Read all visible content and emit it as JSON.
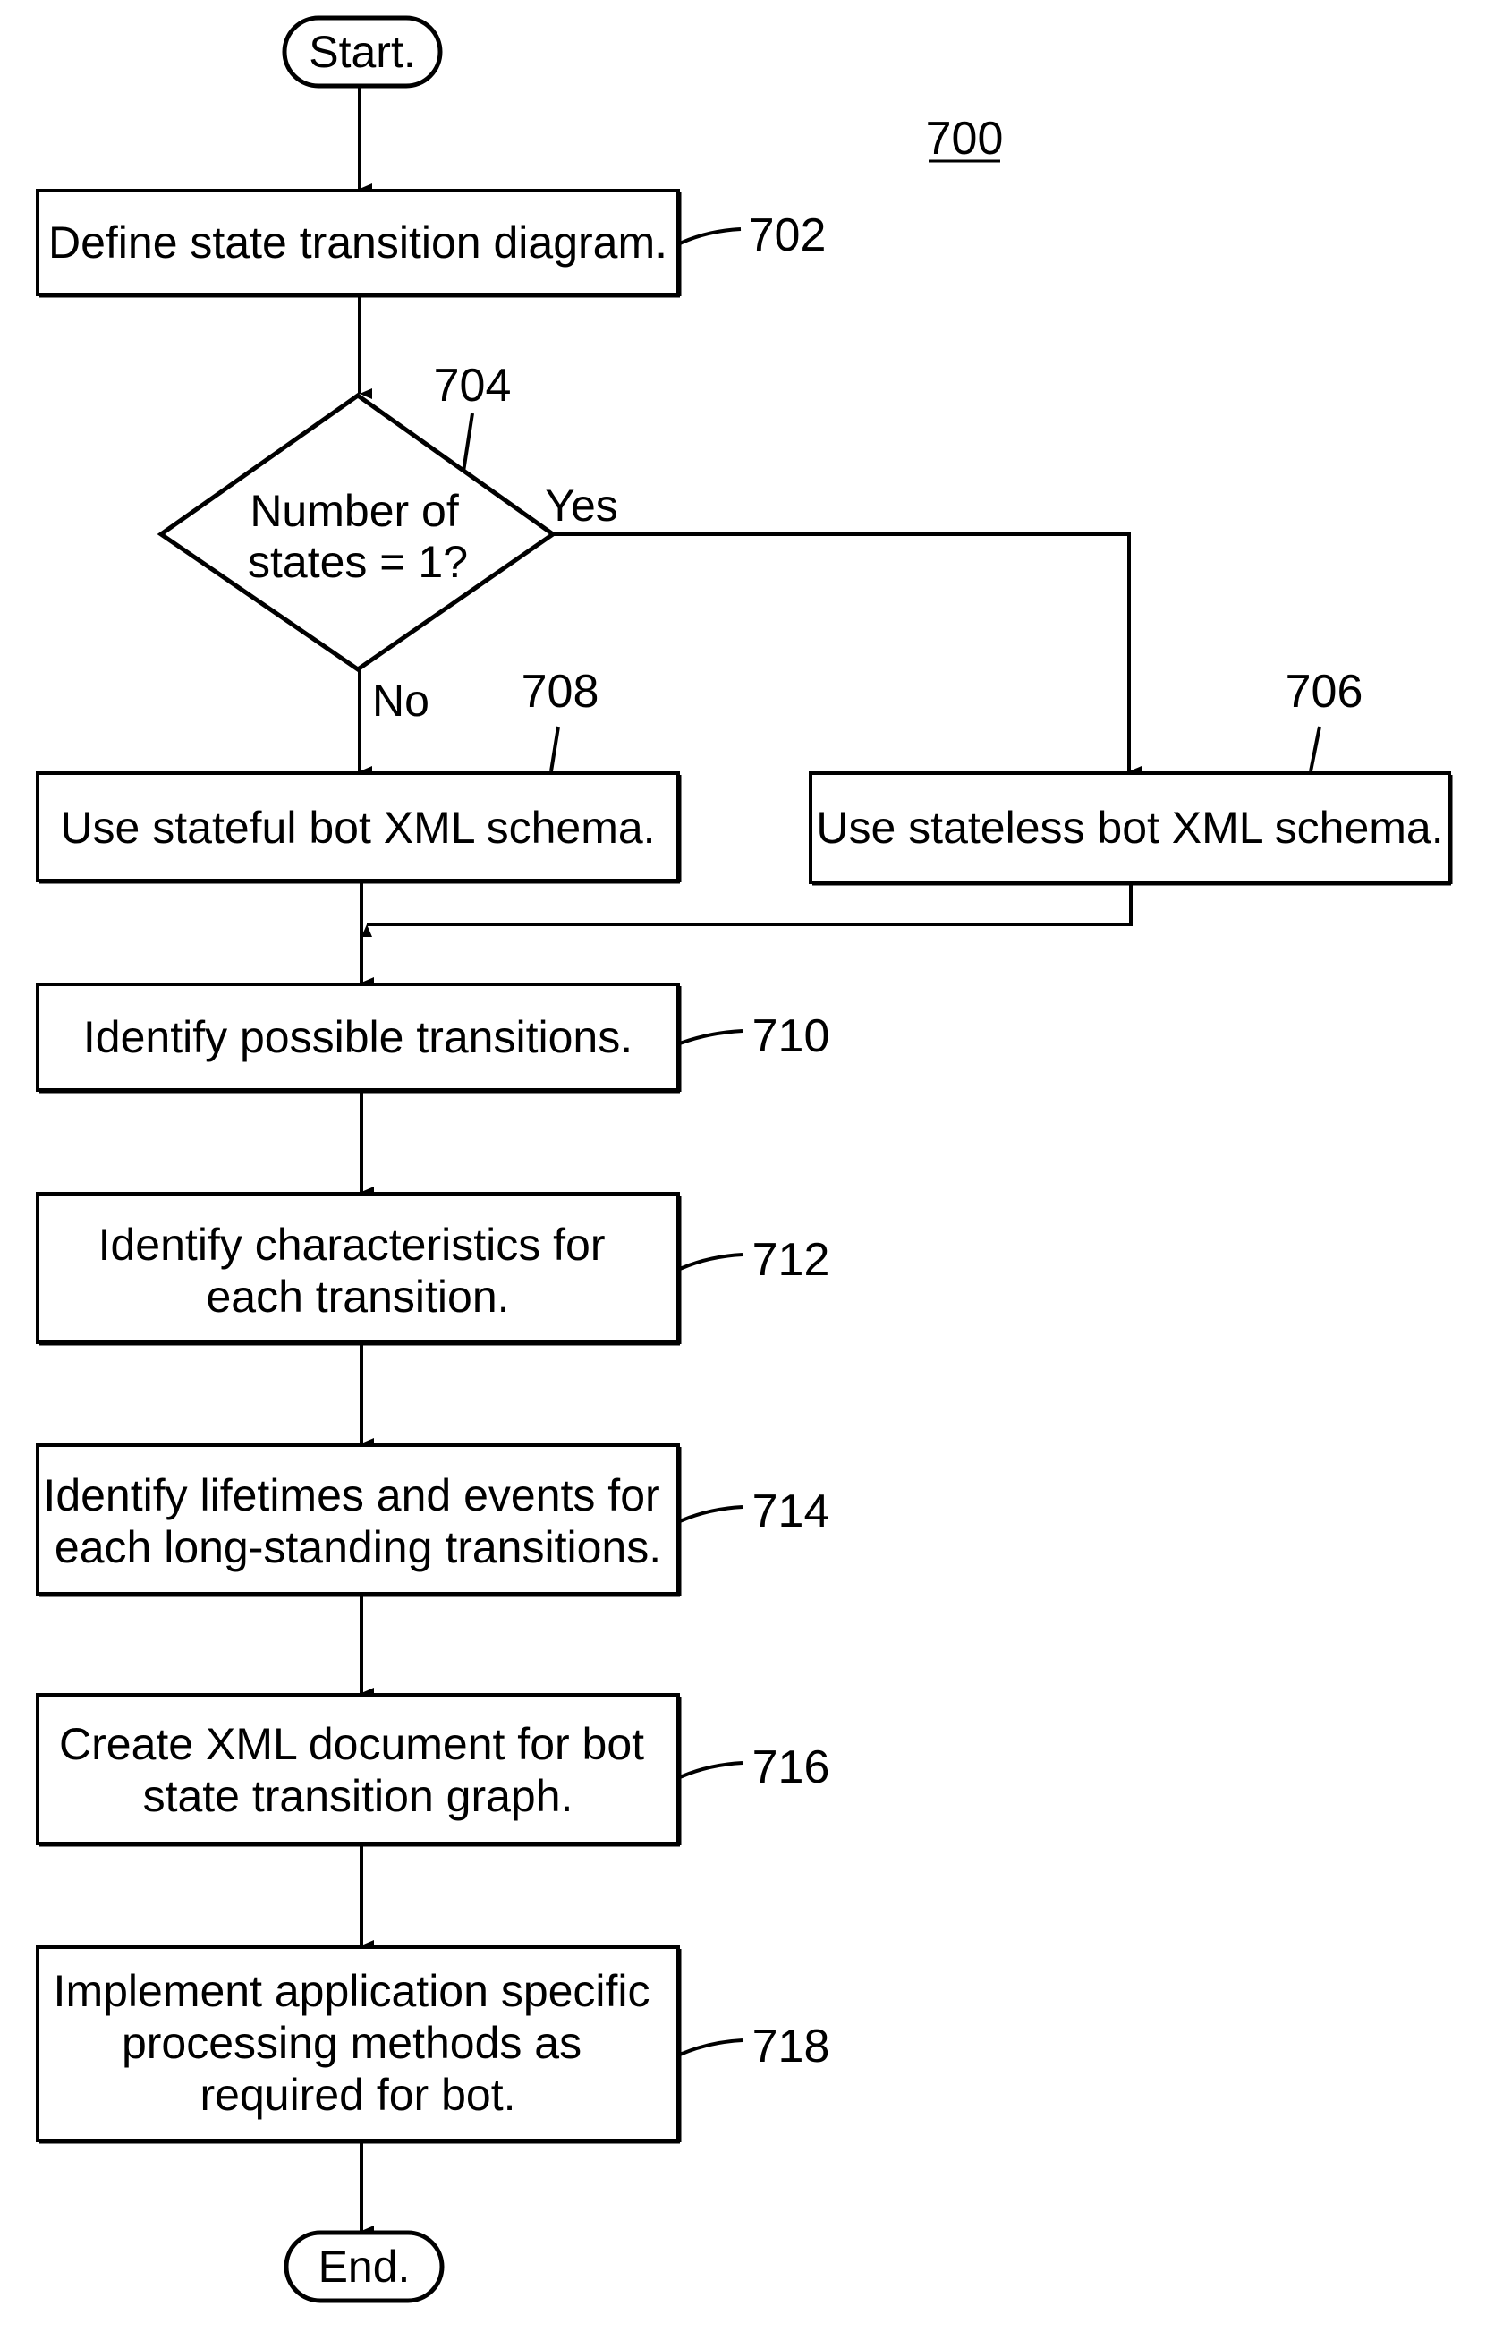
{
  "figure": {
    "number": "700",
    "terminals": {
      "start": "Start.",
      "end": "End."
    },
    "steps": [
      {
        "id": "702",
        "lines": [
          "Define state transition diagram."
        ]
      },
      {
        "id": "708",
        "lines": [
          "Use stateful bot XML schema."
        ]
      },
      {
        "id": "706",
        "lines": [
          "Use stateless bot XML schema."
        ]
      },
      {
        "id": "710",
        "lines": [
          "Identify possible transitions."
        ]
      },
      {
        "id": "712",
        "lines": [
          "Identify characteristics for",
          "each transition."
        ]
      },
      {
        "id": "714",
        "lines": [
          "Identify lifetimes and events for",
          "each long-standing transitions."
        ]
      },
      {
        "id": "716",
        "lines": [
          "Create XML document for bot",
          "state transition graph."
        ]
      },
      {
        "id": "718",
        "lines": [
          "Implement application specific",
          "processing methods as",
          "required for bot."
        ]
      }
    ],
    "decision": {
      "id": "704",
      "lines": [
        "Number of",
        "states = 1?"
      ],
      "yes_label": "Yes",
      "no_label": "No"
    },
    "colors": {
      "stroke": "#000000",
      "background": "#ffffff"
    }
  }
}
